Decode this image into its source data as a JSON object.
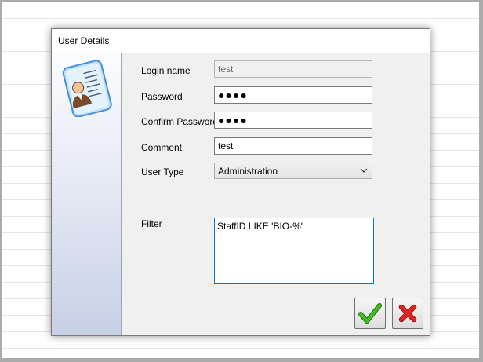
{
  "dialog": {
    "title": "User Details"
  },
  "form": {
    "login_name_label": "Login name",
    "login_name_value": "test",
    "password_label": "Password",
    "password_value": "●●●●",
    "confirm_password_label": "Confirm Password",
    "confirm_password_value": "●●●●",
    "comment_label": "Comment",
    "comment_value": "test",
    "user_type_label": "User Type",
    "user_type_value": "Administration",
    "filter_label": "Filter",
    "filter_value": "StaffID LIKE 'BIO-%'"
  },
  "buttons": {
    "ok_icon": "checkmark-icon",
    "cancel_icon": "x-icon"
  },
  "colors": {
    "ok": "#2f9c1a",
    "cancel": "#d81e1e",
    "focus_border": "#0078d7"
  }
}
